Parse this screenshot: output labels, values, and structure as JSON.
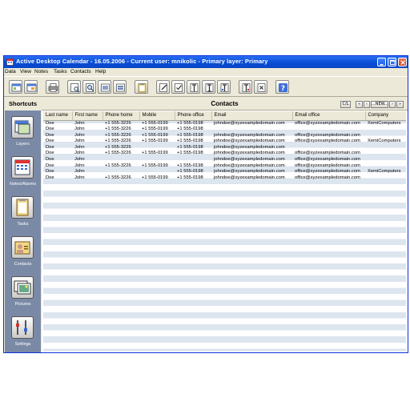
{
  "window": {
    "title": "Active Desktop Calendar - 16.05.2006 - Current user: mnikolic - Primary layer: Primary"
  },
  "menu": [
    "Data",
    "View",
    "Notes",
    "Tasks",
    "Contacts",
    "Help"
  ],
  "toolbar": {
    "icons": [
      "layers-icon",
      "layers-settings-icon",
      "print-icon",
      "preview-icon",
      "find-icon",
      "note-icon",
      "note-list-icon",
      "clipboard-icon",
      "task-edit-icon",
      "task-check-icon",
      "filter-icon",
      "filter2-icon",
      "filter3-icon",
      "filter4-icon",
      "delete-icon",
      "help-icon"
    ],
    "help_symbol": "?"
  },
  "sidebar": {
    "heading": "Shortcuts",
    "items": [
      {
        "label": "Layers",
        "icon": "layers-icon"
      },
      {
        "label": "Notes/Alarms",
        "icon": "calendar-icon"
      },
      {
        "label": "Tasks",
        "icon": "tasks-icon"
      },
      {
        "label": "Contacts",
        "icon": "contacts-icon"
      },
      {
        "label": "Pictures",
        "icon": "pictures-icon"
      },
      {
        "label": "Settings",
        "icon": "settings-icon"
      }
    ]
  },
  "contacts": {
    "title": "Contacts",
    "nav": {
      "first": "«",
      "prev": "‹",
      "new": "...NEW...",
      "next": "›",
      "last": "»",
      "clear": "C/L"
    },
    "columns": [
      "Last name",
      "First name",
      "Phone home",
      "Mobile",
      "Phone office",
      "Email",
      "Email office",
      "Company"
    ],
    "rows": [
      [
        "Doe",
        "John",
        "+1 555-3226",
        "+1 555-0199",
        "+1 555-0198",
        "johndoe@xyzexampledomain.com",
        "office@xyzexampledomain.com",
        "XemiComputers"
      ],
      [
        "Doe",
        "John",
        "+1 555-3226",
        "+1 555-0199",
        "+1 555-0198",
        "",
        "",
        ""
      ],
      [
        "Doe",
        "John",
        "+1 555-3226",
        "+1 555-0199",
        "+1 555-0198",
        "johndoe@xyzexampledomain.com",
        "office@xyzexampledomain.com",
        ""
      ],
      [
        "Doe",
        "John",
        "+1 555-3226",
        "+1 555-0199",
        "+1 555-0198",
        "johndoe@xyzexampledomain.com",
        "office@xyzexampledomain.com",
        "XemiComputers"
      ],
      [
        "Doe",
        "John",
        "+1 555-3226",
        "",
        "+1 555-0198",
        "johndoe@xyzexampledomain.com",
        "",
        ""
      ],
      [
        "Doe",
        "John",
        "+1 555-3226",
        "+1 555-0199",
        "+1 555-0198",
        "johndoe@xyzexampledomain.com",
        "office@xyzexampledomain.com",
        ""
      ],
      [
        "Doe",
        "John",
        "",
        "",
        "",
        "johndoe@xyzexampledomain.com",
        "office@xyzexampledomain.com",
        ""
      ],
      [
        "Doe",
        "John",
        "+1 555-3226",
        "+1 555-0199",
        "+1 555-0198",
        "johndoe@xyzexampledomain.com",
        "office@xyzexampledomain.com",
        ""
      ],
      [
        "Doe",
        "John",
        "",
        "",
        "+1 555-0198",
        "johndoe@xyzexampledomain.com",
        "office@xyzexampledomain.com",
        "XemiComputers"
      ],
      [
        "Doe",
        "John",
        "+1 555-3226",
        "+1 555-0199",
        "+1 555-0198",
        "johndoe@xyzexampledomain.com",
        "office@xyzexampledomain.com",
        ""
      ]
    ]
  },
  "colors": {
    "titlebar": "#0a4fd6",
    "sidebar": "#7a8aa6",
    "row_alt": "#dde5ef",
    "chrome": "#ece9d8"
  }
}
